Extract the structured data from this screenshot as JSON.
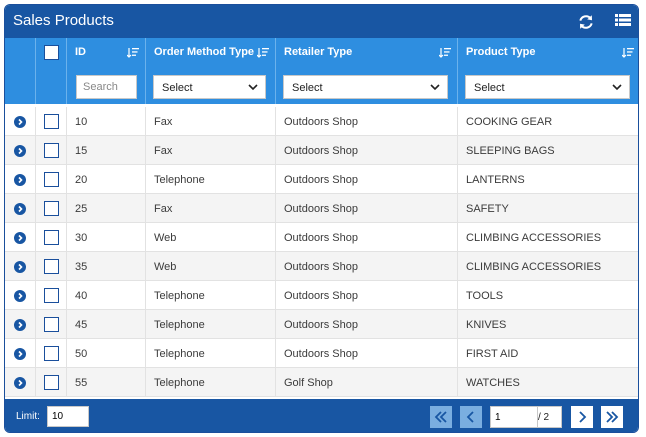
{
  "window": {
    "title": "Sales Products"
  },
  "toolbar": {
    "refresh_icon": "refresh-icon",
    "menu_icon": "grid-menu-icon"
  },
  "columns": {
    "id": "ID",
    "order_method_type": "Order Method Type",
    "retailer_type": "Retailer Type",
    "product_type": "Product Type"
  },
  "filters": {
    "id_placeholder": "Search",
    "order_method_type": "Select",
    "retailer_type": "Select",
    "product_type": "Select"
  },
  "rows": [
    {
      "id": "10",
      "order_method_type": "Fax",
      "retailer_type": "Outdoors Shop",
      "product_type": "COOKING GEAR"
    },
    {
      "id": "15",
      "order_method_type": "Fax",
      "retailer_type": "Outdoors Shop",
      "product_type": "SLEEPING BAGS"
    },
    {
      "id": "20",
      "order_method_type": "Telephone",
      "retailer_type": "Outdoors Shop",
      "product_type": "LANTERNS"
    },
    {
      "id": "25",
      "order_method_type": "Fax",
      "retailer_type": "Outdoors Shop",
      "product_type": "SAFETY"
    },
    {
      "id": "30",
      "order_method_type": "Web",
      "retailer_type": "Outdoors Shop",
      "product_type": "CLIMBING ACCESSORIES"
    },
    {
      "id": "35",
      "order_method_type": "Web",
      "retailer_type": "Outdoors Shop",
      "product_type": "CLIMBING ACCESSORIES"
    },
    {
      "id": "40",
      "order_method_type": "Telephone",
      "retailer_type": "Outdoors Shop",
      "product_type": "TOOLS"
    },
    {
      "id": "45",
      "order_method_type": "Telephone",
      "retailer_type": "Outdoors Shop",
      "product_type": "KNIVES"
    },
    {
      "id": "50",
      "order_method_type": "Telephone",
      "retailer_type": "Outdoors Shop",
      "product_type": "FIRST AID"
    },
    {
      "id": "55",
      "order_method_type": "Telephone",
      "retailer_type": "Golf Shop",
      "product_type": "WATCHES"
    }
  ],
  "footer": {
    "limit_label": "Limit:",
    "limit_value": "10",
    "current_page": "1",
    "total_pages": "/ 2"
  },
  "colors": {
    "title_bar": "#1856a3",
    "header": "#2e8ee0",
    "footer": "#1856a3"
  }
}
